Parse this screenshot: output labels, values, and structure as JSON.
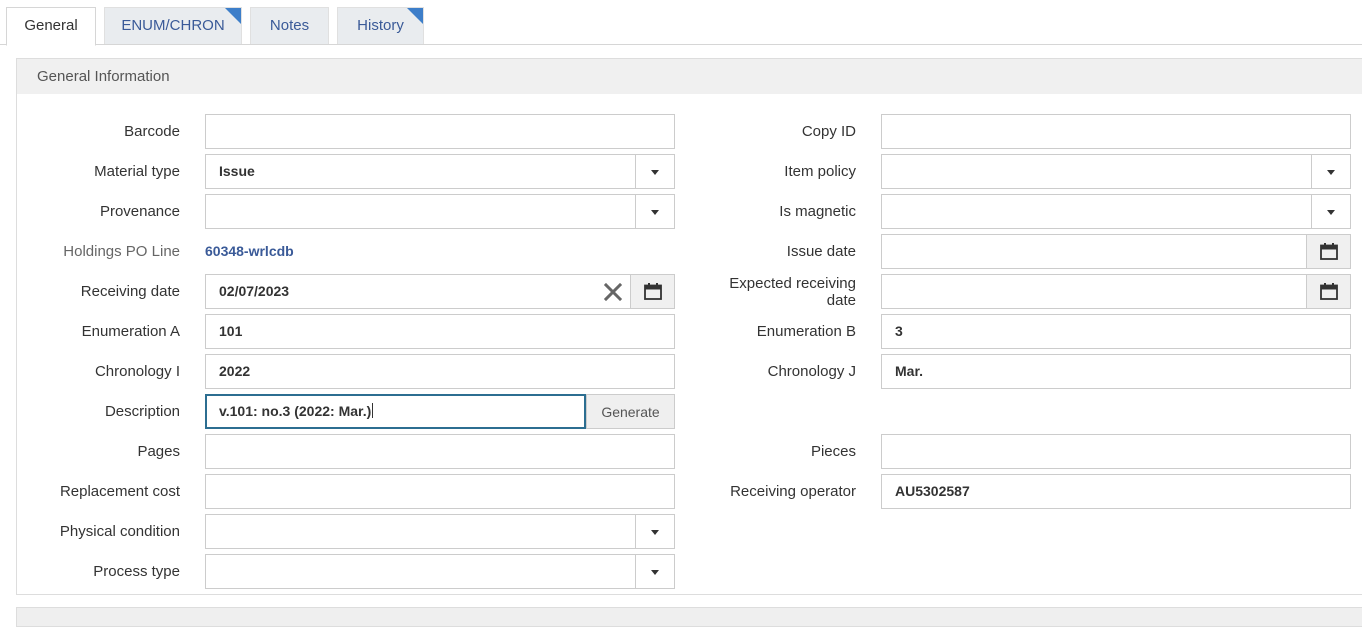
{
  "tabs": [
    {
      "label": "General",
      "active": true
    },
    {
      "label": "ENUM/CHRON",
      "active": false
    },
    {
      "label": "Notes",
      "active": false
    },
    {
      "label": "History",
      "active": false
    }
  ],
  "section": {
    "title": "General Information"
  },
  "left_fields": {
    "barcode": {
      "label": "Barcode",
      "value": ""
    },
    "material_type": {
      "label": "Material type",
      "value": "Issue"
    },
    "provenance": {
      "label": "Provenance",
      "value": ""
    },
    "holdings_po_line": {
      "label": "Holdings PO Line",
      "value": "60348-wrlcdb"
    },
    "receiving_date": {
      "label": "Receiving date",
      "value": "02/07/2023"
    },
    "enumeration_a": {
      "label": "Enumeration A",
      "value": "101"
    },
    "chronology_i": {
      "label": "Chronology I",
      "value": "2022"
    },
    "description": {
      "label": "Description",
      "value": "v.101: no.3 (2022: Mar.)",
      "button": "Generate"
    },
    "pages": {
      "label": "Pages",
      "value": ""
    },
    "replacement_cost": {
      "label": "Replacement cost",
      "value": ""
    },
    "physical_condition": {
      "label": "Physical condition",
      "value": ""
    },
    "process_type": {
      "label": "Process type",
      "value": ""
    }
  },
  "right_fields": {
    "copy_id": {
      "label": "Copy ID",
      "value": ""
    },
    "item_policy": {
      "label": "Item policy",
      "value": ""
    },
    "is_magnetic": {
      "label": "Is magnetic",
      "value": ""
    },
    "issue_date": {
      "label": "Issue date",
      "value": ""
    },
    "expected_receiving_date": {
      "label_line1": "Expected receiving",
      "label_line2": "date",
      "value": ""
    },
    "enumeration_b": {
      "label": "Enumeration B",
      "value": "3"
    },
    "chronology_j": {
      "label": "Chronology J",
      "value": "Mar."
    },
    "pieces": {
      "label": "Pieces",
      "value": ""
    },
    "receiving_operator": {
      "label": "Receiving operator",
      "value": "AU5302587"
    }
  },
  "colors": {
    "link": "#3a5a98",
    "corner_marker": "#3d7ec9",
    "focus_border": "#2c6e91"
  },
  "icons": [
    "calendar-icon",
    "clear-x-icon",
    "caret-down-icon",
    "tab-corner-marker"
  ]
}
